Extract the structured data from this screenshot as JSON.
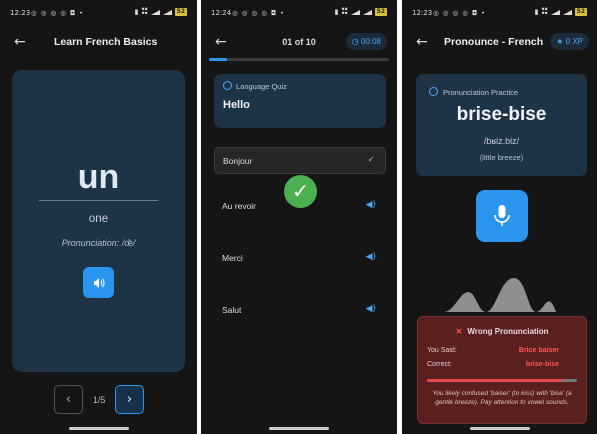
{
  "screen1": {
    "status_time": "12:23",
    "battery": "52",
    "title": "Learn French Basics",
    "word": "un",
    "translation": "one",
    "pronunciation": "Pronunciation: /œ̃/",
    "pager": "1/5",
    "icons": {
      "back": "arrow-left",
      "speaker": "speaker",
      "prev": "chevron-left",
      "next": "chevron-right"
    }
  },
  "screen2": {
    "status_time": "12:24",
    "battery": "52",
    "counter": "01 of 10",
    "timer": "00:08",
    "progress": 0.1,
    "quiz_label": "Language Quiz",
    "quiz_word": "Hello",
    "options": [
      {
        "label": "Bonjour",
        "selected": true,
        "icon": "check"
      },
      {
        "label": "Au revoir",
        "selected": false,
        "icon": "speaker"
      },
      {
        "label": "Merci",
        "selected": false,
        "icon": "speaker"
      },
      {
        "label": "Salut",
        "selected": false,
        "icon": "speaker"
      }
    ]
  },
  "screen3": {
    "status_time": "12:23",
    "battery": "52",
    "title": "Pronounce - French",
    "xp": "0 XP",
    "card_label": "Pronunciation Practice",
    "word": "brise-bise",
    "ipa": "/bʁiz.biz/",
    "gloss": "(little breeze)",
    "error": {
      "title": "Wrong Pronunciation",
      "you_said_label": "You Said:",
      "you_said_value": "Brice baiser",
      "correct_label": "Correct:",
      "correct_value": "brise-bise",
      "score": 0.9,
      "note": "You likely confused 'baiser' (to kiss) with 'bise' (a gentle breeze). Pay attention to vowel sounds."
    }
  },
  "colors": {
    "accent": "#2b96f0",
    "card": "#1f3347",
    "success": "#4caf50",
    "error_bg": "#5a1f1f",
    "error_text": "#ff5a5a"
  }
}
